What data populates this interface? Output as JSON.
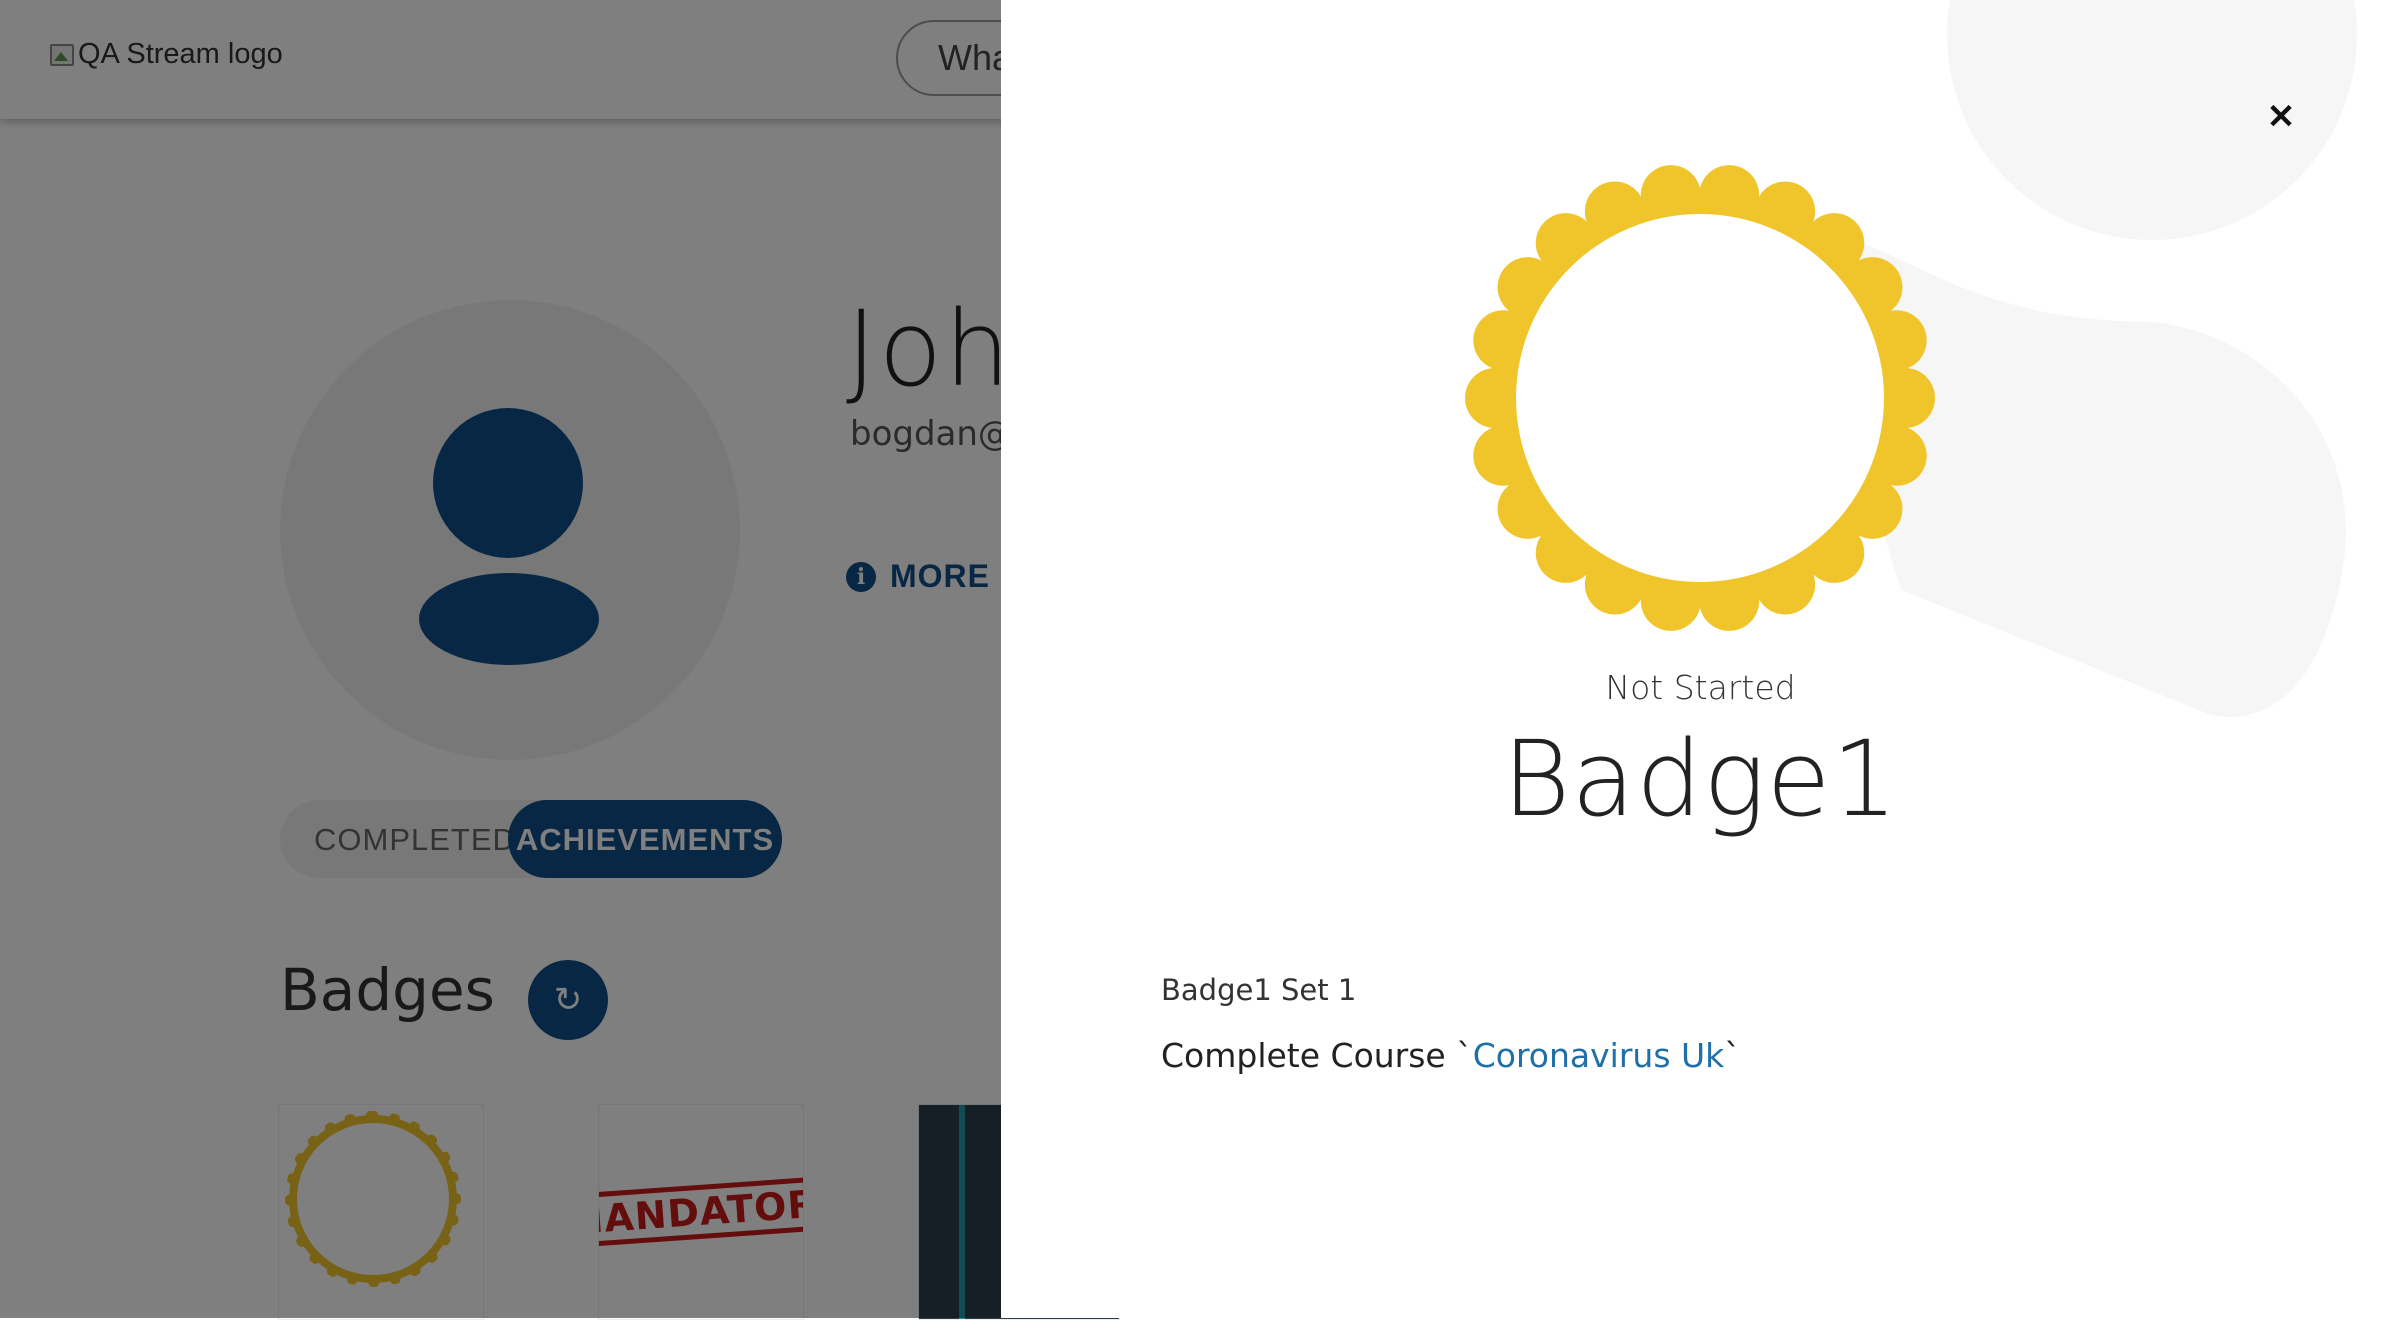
{
  "header": {
    "logo_alt": "QA Stream logo",
    "search_placeholder": "Wha"
  },
  "profile": {
    "name": "Joh",
    "email": "bogdan@",
    "more_info_label": "MORE IN"
  },
  "tabs": [
    {
      "label": "COMPLETED",
      "active": false
    },
    {
      "label": "ACHIEVEMENTS",
      "active": true
    }
  ],
  "badges_section": {
    "heading": "Badges",
    "cards": [
      {
        "image": "badge-ring"
      },
      {
        "image": "mandatory-stamp",
        "stamp_text": "IANDATORY"
      },
      {
        "image": "tablet-photo"
      }
    ]
  },
  "panel": {
    "status": "Not Started",
    "title": "Badge1",
    "set_label": "Badge1 Set 1",
    "requirement_prefix": "Complete Course `",
    "requirement_link": "Coronavirus Uk",
    "requirement_suffix": "`"
  },
  "colors": {
    "brand": "#0e4e88",
    "badge_gold": "#f0c52c",
    "link": "#1f6fa8"
  }
}
